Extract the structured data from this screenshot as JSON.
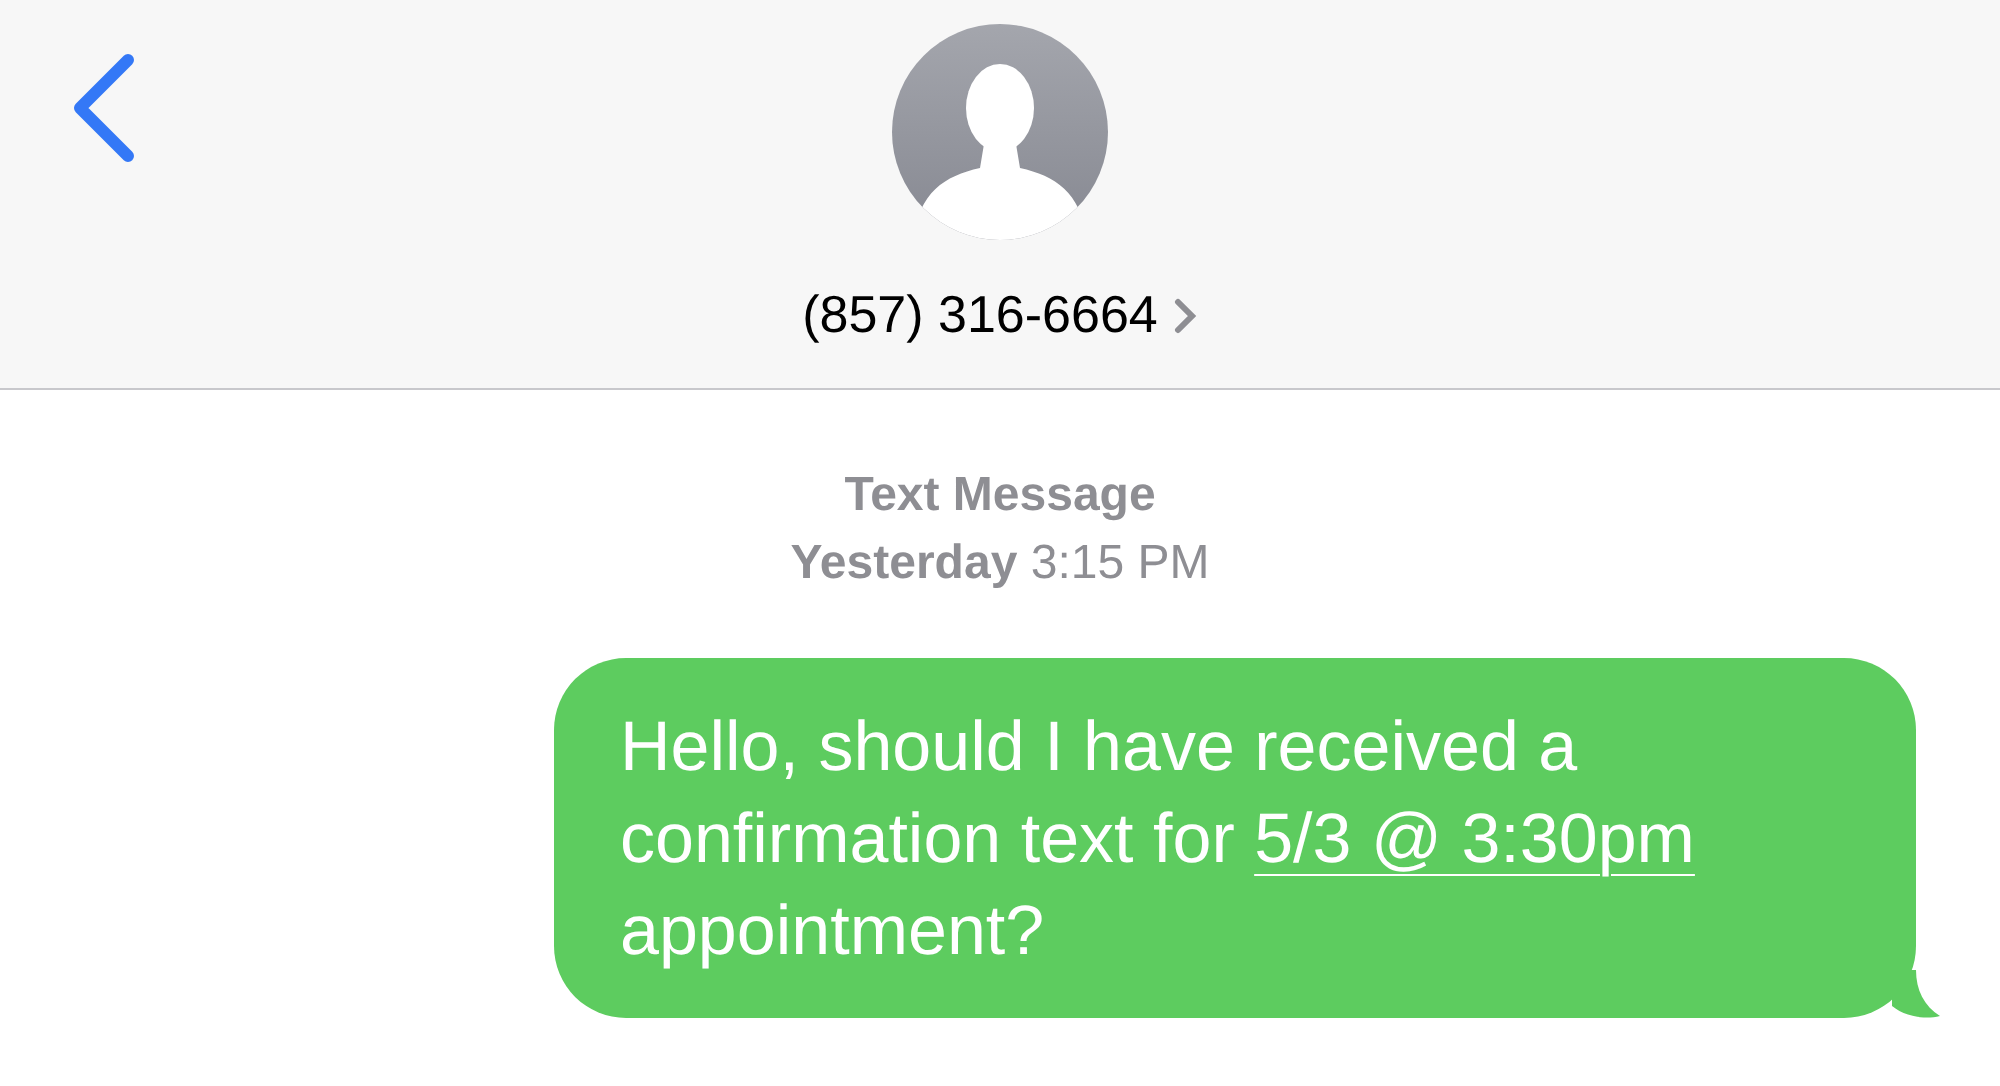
{
  "header": {
    "contact": "(857) 316-6664"
  },
  "meta": {
    "service": "Text Message",
    "day": "Yesterday",
    "time": "3:15 PM"
  },
  "messages": [
    {
      "kind": "sent",
      "text": "Hello, should I have received a confirmation text for ",
      "link": "5/3 @ 3:30pm",
      "text_after": " appointment?"
    }
  ]
}
